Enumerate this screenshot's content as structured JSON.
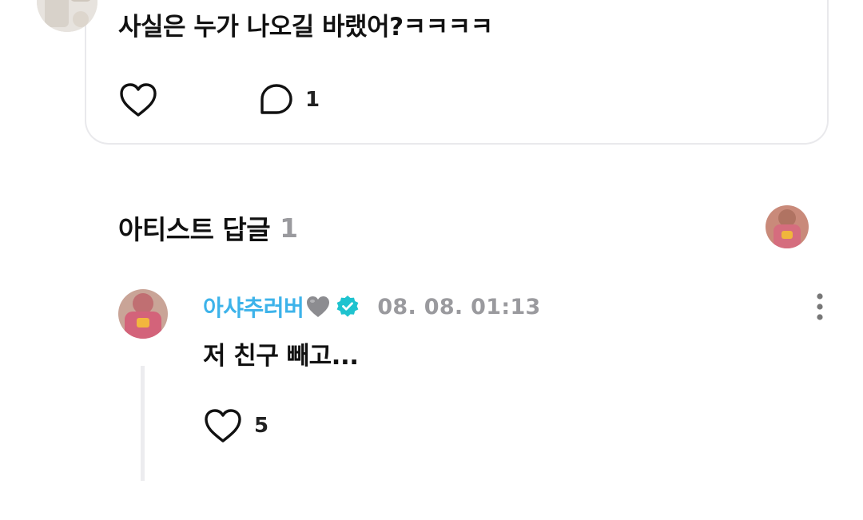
{
  "post": {
    "text": "사실은 누가 나오길 바랬어?ㅋㅋㅋㅋ",
    "comment_count": "1"
  },
  "artist_replies": {
    "title": "아티스트 답글",
    "count": "1"
  },
  "reply": {
    "author": "아샤추러버",
    "time": "08. 08. 01:13",
    "text": "저 친구 빼고...",
    "like_count": "5"
  },
  "colors": {
    "author": "#3db3ea",
    "verified": "#1fc3cf",
    "muted": "#9a9a9e",
    "card_border": "#e9e9ec"
  },
  "icons": [
    "heart-outline-icon",
    "speech-bubble-icon",
    "grey-heart-emoji",
    "verified-badge-icon",
    "more-vertical-icon"
  ]
}
